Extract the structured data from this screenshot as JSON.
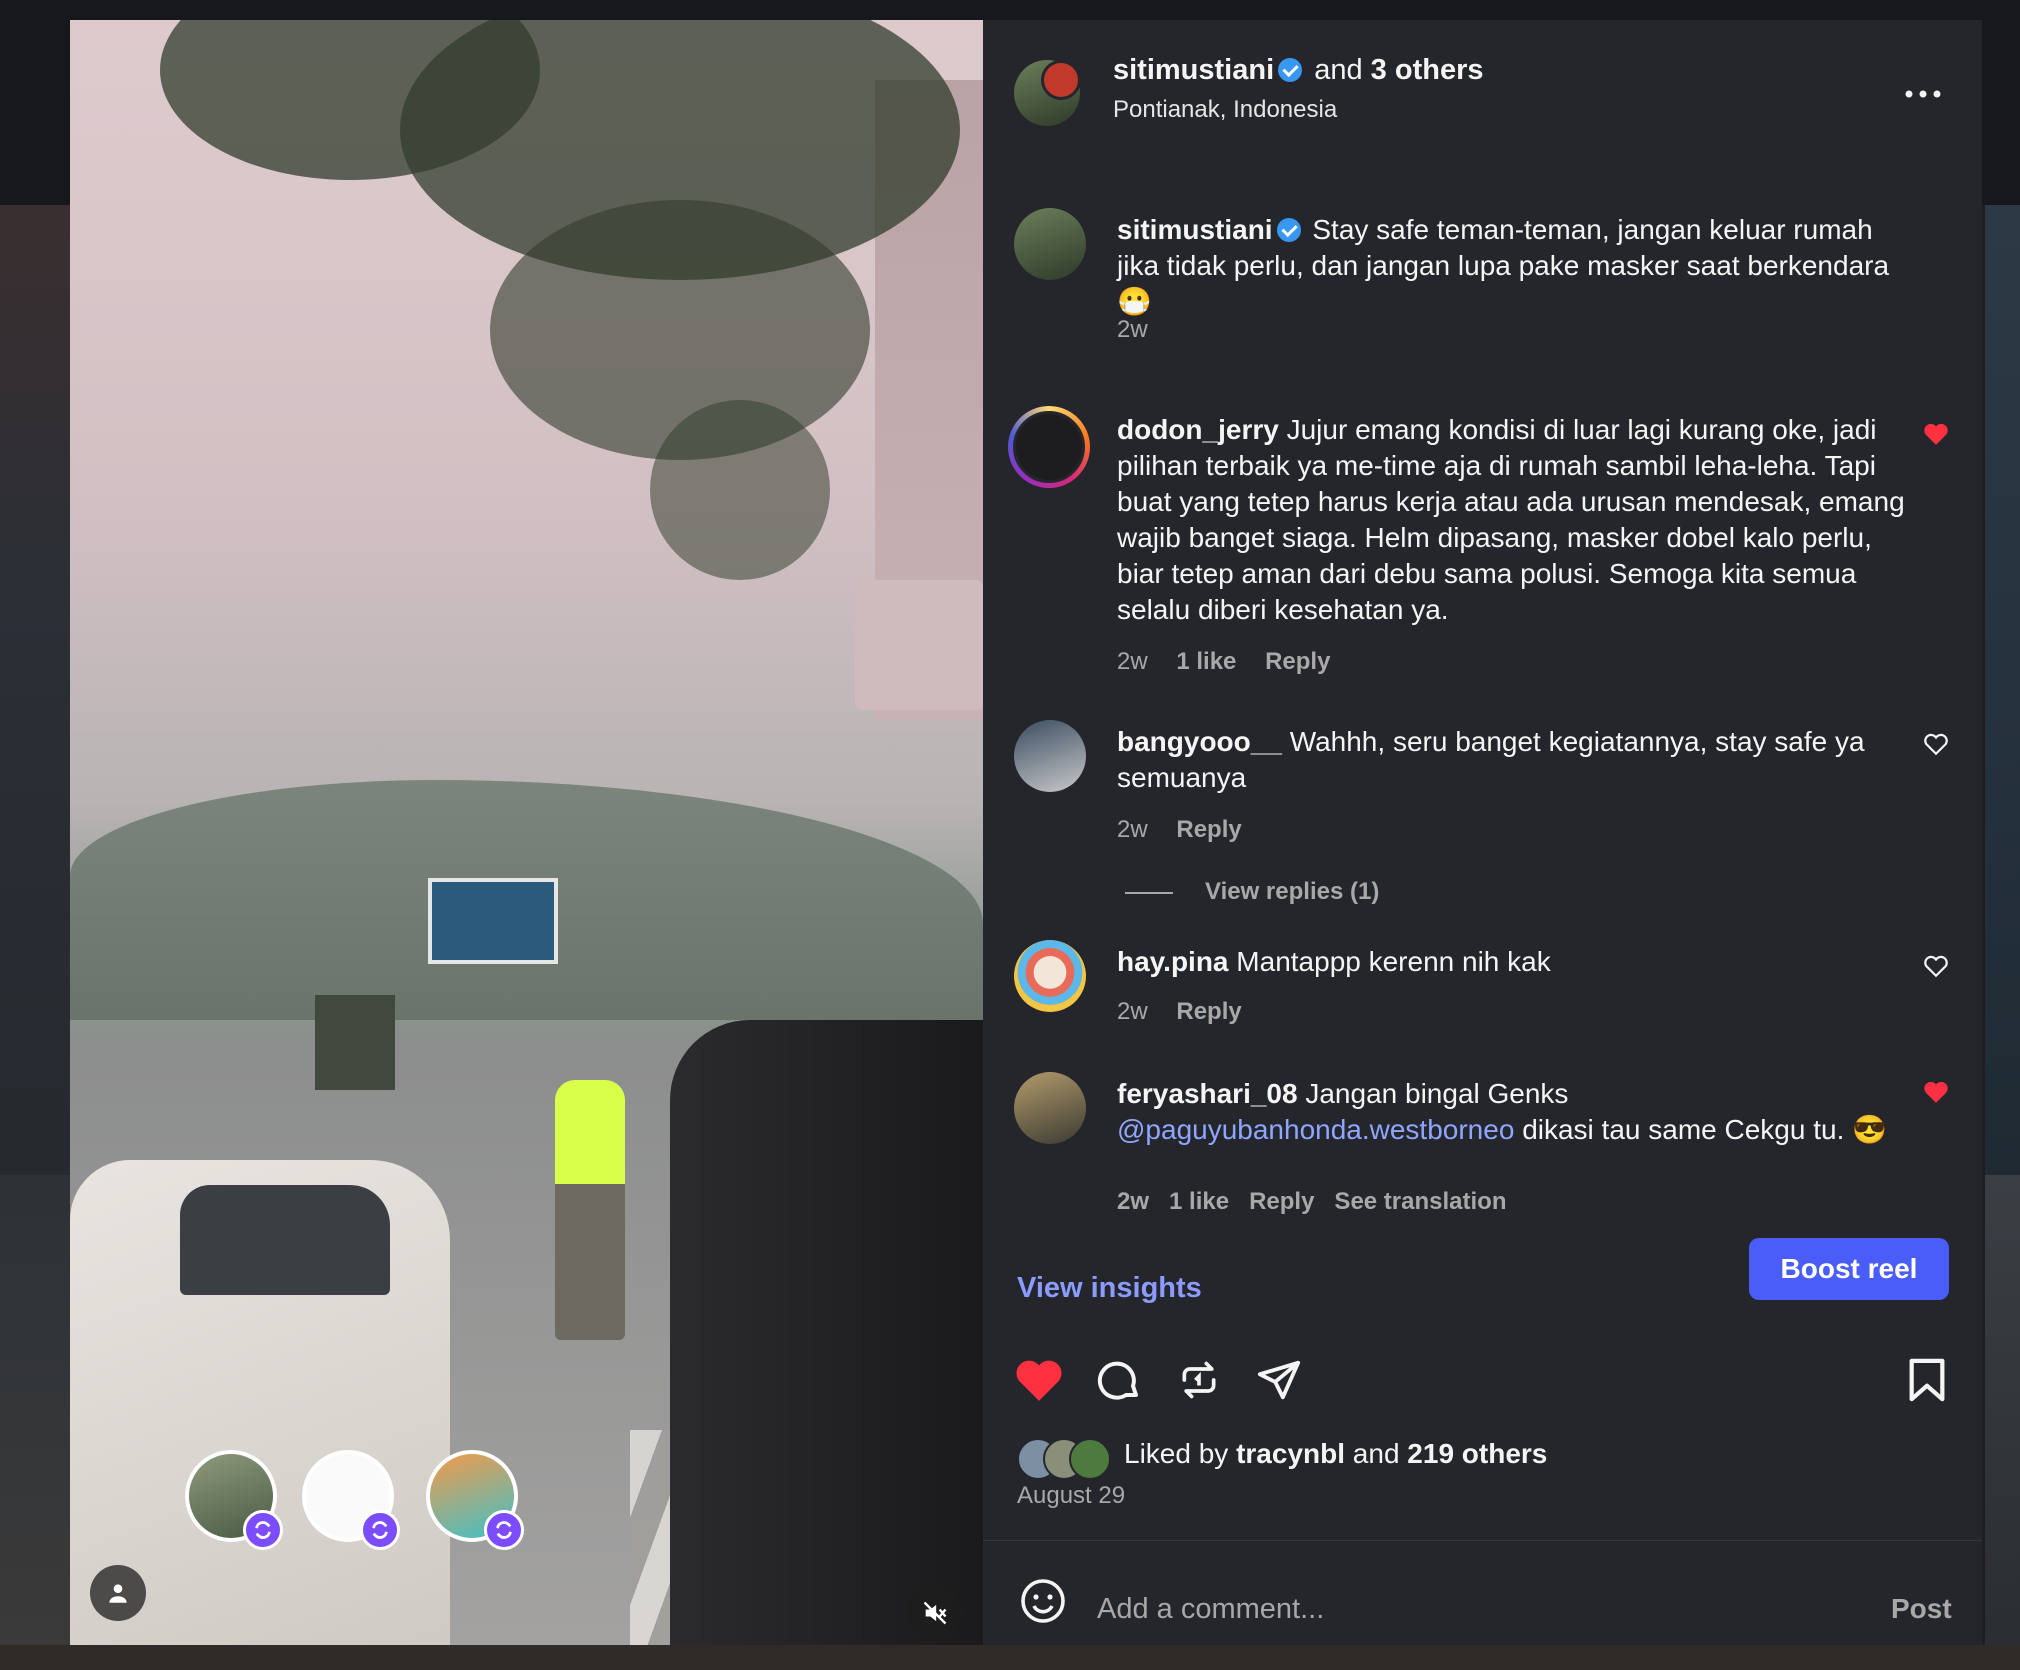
{
  "post": {
    "author": "sitimustiani",
    "collab_text_prefix": "and",
    "collab_count_text": "3 others",
    "location": "Pontianak, Indonesia",
    "more_icon": "more-horizontal-icon"
  },
  "comments": [
    {
      "username": "sitimustiani",
      "verified": true,
      "text": "Stay safe teman-teman, jangan keluar rumah jika tidak perlu, dan jangan lupa pake masker saat berkendara 😷",
      "age": "2w"
    },
    {
      "username": "dodon_jerry",
      "text": "Jujur emang kondisi di luar lagi kurang oke, jadi pilihan terbaik ya me-time aja di rumah sambil leha-leha. Tapi buat yang tetep harus kerja atau ada urusan mendesak, emang wajib banget siaga. Helm dipasang, masker dobel kalo perlu, biar tetep aman dari debu sama polusi. Semoga kita semua selalu diberi kesehatan ya.",
      "age": "2w",
      "likes": "1 like",
      "reply": "Reply",
      "liked": true
    },
    {
      "username": "bangyooo__",
      "text": "Wahhh, seru banget kegiatannya, stay safe ya semuanya",
      "age": "2w",
      "reply": "Reply",
      "view_replies": "View replies (1)",
      "liked": false
    },
    {
      "username": "hay.pina",
      "text": "Mantappp kerenn nih kak",
      "age": "2w",
      "reply": "Reply",
      "liked": false
    },
    {
      "username": "feryashari_08",
      "text_before": "Jangan bingal Genks",
      "mention": "@paguyubanhonda.westborneo",
      "text_after": "dikasi tau same Cekgu tu. 😎",
      "meta_cut": "2w   1 like   Reply   See translation",
      "liked": true
    }
  ],
  "actions": {
    "view_insights": "View insights",
    "boost": "Boost reel",
    "liked_by_prefix": "Liked by",
    "liked_by_user": "tracynbl",
    "liked_by_and": "and",
    "liked_by_others": "219 others",
    "date": "August 29"
  },
  "composer": {
    "placeholder": "Add a comment...",
    "post": "Post"
  },
  "colors": {
    "accent": "#4a5df9",
    "link": "#8c9bff",
    "like": "#ff3040",
    "panel": "#24262c"
  }
}
